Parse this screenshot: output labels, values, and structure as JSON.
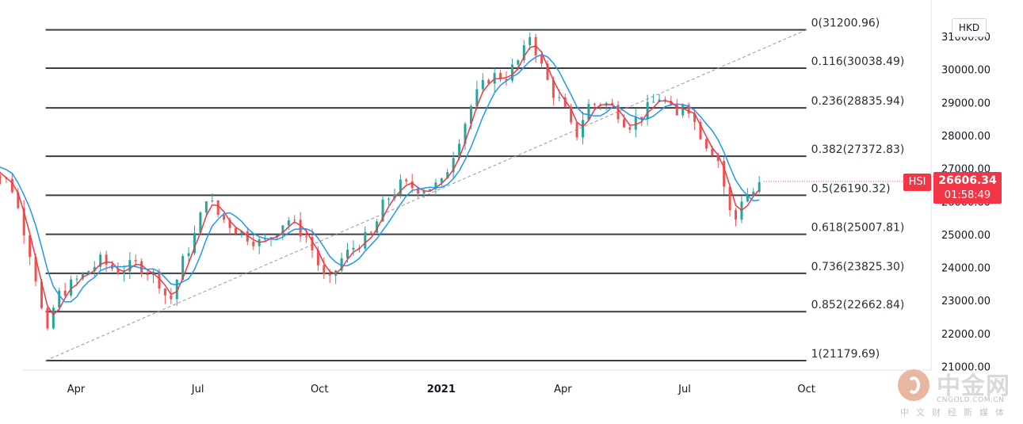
{
  "chart_data": {
    "type": "candlestick",
    "symbol": "HSI",
    "currency": "HKD",
    "last_price": "26606.34",
    "countdown": "01:58:49",
    "y_range": [
      20900,
      31300
    ],
    "y_ticks": [
      "21000.00",
      "22000.00",
      "23000.00",
      "24000.00",
      "25000.00",
      "26000.00",
      "27000.00",
      "28000.00",
      "29000.00",
      "30000.00",
      "31000.00"
    ],
    "x_ticks": [
      {
        "label": "Apr",
        "month_index": 0,
        "bold": false
      },
      {
        "label": "Jul",
        "month_index": 3,
        "bold": false
      },
      {
        "label": "Oct",
        "month_index": 6,
        "bold": false
      },
      {
        "label": "2021",
        "month_index": 9,
        "bold": true
      },
      {
        "label": "Apr",
        "month_index": 12,
        "bold": false
      },
      {
        "label": "Jul",
        "month_index": 15,
        "bold": false
      },
      {
        "label": "Oct",
        "month_index": 18,
        "bold": false
      }
    ],
    "fib_levels": [
      {
        "label": "0(31200.96)",
        "value": 31200.96
      },
      {
        "label": "0.116(30038.49)",
        "value": 30038.49
      },
      {
        "label": "0.236(28835.94)",
        "value": 28835.94
      },
      {
        "label": "0.382(27372.83)",
        "value": 27372.83
      },
      {
        "label": "0.5(26190.32)",
        "value": 26190.32
      },
      {
        "label": "0.618(25007.81)",
        "value": 25007.81
      },
      {
        "label": "0.736(23825.30)",
        "value": 23825.3
      },
      {
        "label": "0.852(22662.84)",
        "value": 22662.84
      },
      {
        "label": "1(21179.69)",
        "value": 21179.69
      }
    ],
    "trend_line": {
      "from": {
        "month_index": -0.75,
        "value": 21179.69
      },
      "to": {
        "month_index": 18.0,
        "value": 31200.96
      }
    },
    "price_path": [
      [
        -2.3,
        27550
      ],
      [
        -2.0,
        26900
      ],
      [
        -1.6,
        26500
      ],
      [
        -1.2,
        24800
      ],
      [
        -0.9,
        23200
      ],
      [
        -0.75,
        21700
      ],
      [
        -0.5,
        23100
      ],
      [
        -0.2,
        23400
      ],
      [
        0.2,
        23800
      ],
      [
        0.6,
        24200
      ],
      [
        1.0,
        23900
      ],
      [
        1.5,
        24100
      ],
      [
        2.0,
        23700
      ],
      [
        2.3,
        22900
      ],
      [
        2.6,
        24100
      ],
      [
        3.0,
        25200
      ],
      [
        3.2,
        26200
      ],
      [
        3.5,
        25600
      ],
      [
        4.0,
        25100
      ],
      [
        4.6,
        24700
      ],
      [
        5.2,
        25500
      ],
      [
        5.7,
        24900
      ],
      [
        6.2,
        23400
      ],
      [
        6.5,
        24200
      ],
      [
        6.9,
        24700
      ],
      [
        7.3,
        25000
      ],
      [
        7.6,
        26000
      ],
      [
        8.0,
        26500
      ],
      [
        8.5,
        26400
      ],
      [
        9.0,
        26500
      ],
      [
        9.4,
        27800
      ],
      [
        9.8,
        29100
      ],
      [
        10.2,
        29800
      ],
      [
        10.6,
        29800
      ],
      [
        11.0,
        30400
      ],
      [
        11.2,
        31100
      ],
      [
        11.4,
        30300
      ],
      [
        11.7,
        29400
      ],
      [
        12.0,
        28900
      ],
      [
        12.3,
        27900
      ],
      [
        12.6,
        28900
      ],
      [
        13.0,
        29000
      ],
      [
        13.3,
        28800
      ],
      [
        13.6,
        28300
      ],
      [
        14.0,
        28700
      ],
      [
        14.4,
        29200
      ],
      [
        14.8,
        28500
      ],
      [
        15.0,
        29200
      ],
      [
        15.2,
        28500
      ],
      [
        15.5,
        27800
      ],
      [
        15.8,
        27400
      ],
      [
        16.0,
        26300
      ],
      [
        16.2,
        25200
      ],
      [
        16.4,
        26100
      ],
      [
        16.7,
        26300
      ],
      [
        16.95,
        26606
      ]
    ],
    "moving_averages": [
      {
        "color": "#f23645",
        "lag": 0.25
      },
      {
        "color": "#2196f3",
        "lag": 0.7
      }
    ],
    "colors": {
      "up": "#26a69a",
      "down": "#ef5350",
      "fib": "#3a3d45",
      "trend": "#9598a1"
    }
  },
  "watermark": {
    "brand": "中金网",
    "url": "CNGOLD.COM.CN",
    "tagline": "中文财经新媒体"
  }
}
